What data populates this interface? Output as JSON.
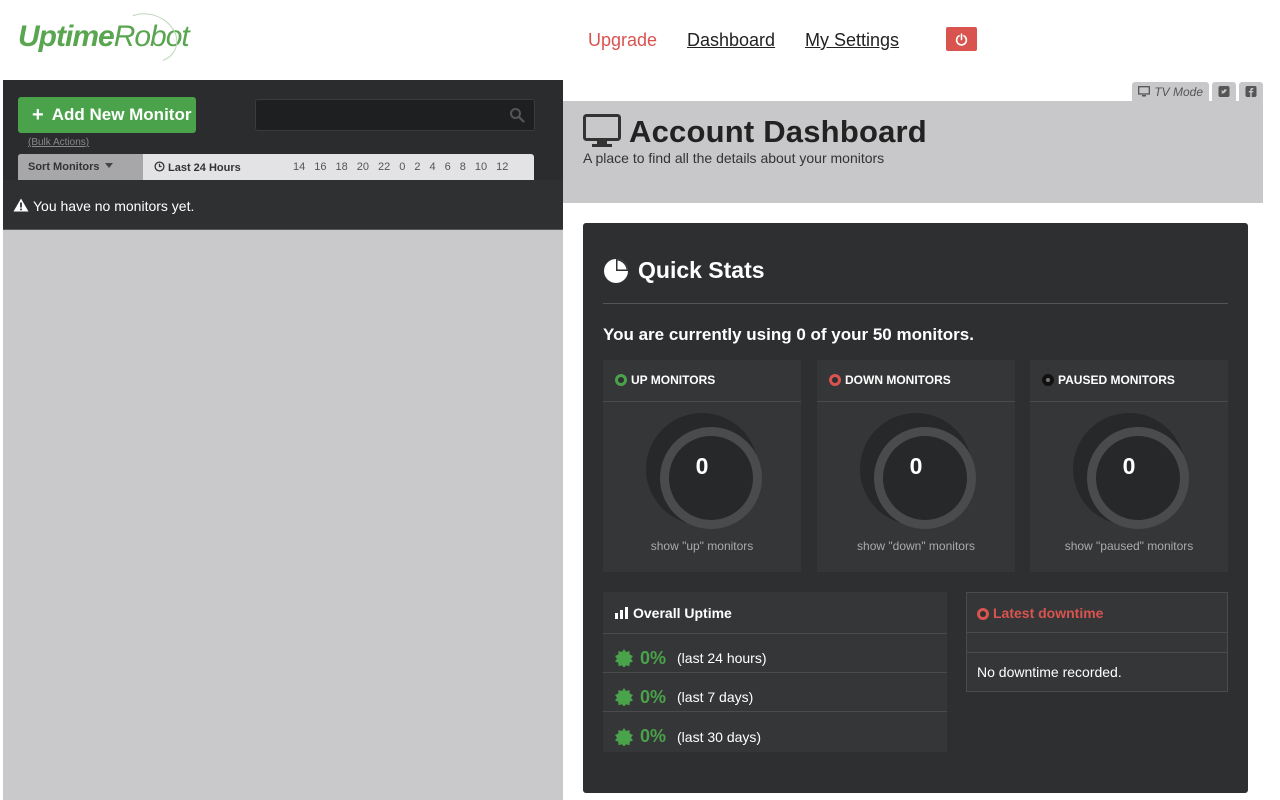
{
  "header": {
    "logo_part1": "Uptime",
    "logo_part2": "Robot",
    "nav": {
      "upgrade": "Upgrade",
      "dashboard": "Dashboard",
      "settings": "My Settings"
    }
  },
  "sidebar": {
    "add_button": "Add New Monitor",
    "bulk_actions": "(Bulk Actions)",
    "search_placeholder": "",
    "sort_label": "Sort Monitors",
    "time_range": "Last 24 Hours",
    "hours": [
      "14",
      "16",
      "18",
      "20",
      "22",
      "0",
      "2",
      "4",
      "6",
      "8",
      "10",
      "12"
    ],
    "empty_message": "You have no monitors yet."
  },
  "main": {
    "tv_mode": "TV Mode",
    "title": "Account Dashboard",
    "subtitle": "A place to find all the details about your monitors",
    "quick_stats": {
      "title": "Quick Stats",
      "usage": "You are currently using 0 of your 50 monitors.",
      "boxes": [
        {
          "label": "UP MONITORS",
          "count": "0",
          "link": "show \"up\" monitors"
        },
        {
          "label": "DOWN MONITORS",
          "count": "0",
          "link": "show \"down\" monitors"
        },
        {
          "label": "PAUSED MONITORS",
          "count": "0",
          "link": "show \"paused\" monitors"
        }
      ],
      "uptime": {
        "title": "Overall Uptime",
        "rows": [
          {
            "value": "0%",
            "period": "(last 24 hours)"
          },
          {
            "value": "0%",
            "period": "(last 7 days)"
          },
          {
            "value": "0%",
            "period": "(last 30 days)"
          }
        ]
      },
      "downtime": {
        "title": "Latest downtime",
        "message": "No downtime recorded."
      }
    }
  },
  "colors": {
    "brand_green": "#5aa550",
    "up_green": "#4aa24a",
    "down_red": "#d9534f",
    "panel_dark": "#2e2f31"
  }
}
